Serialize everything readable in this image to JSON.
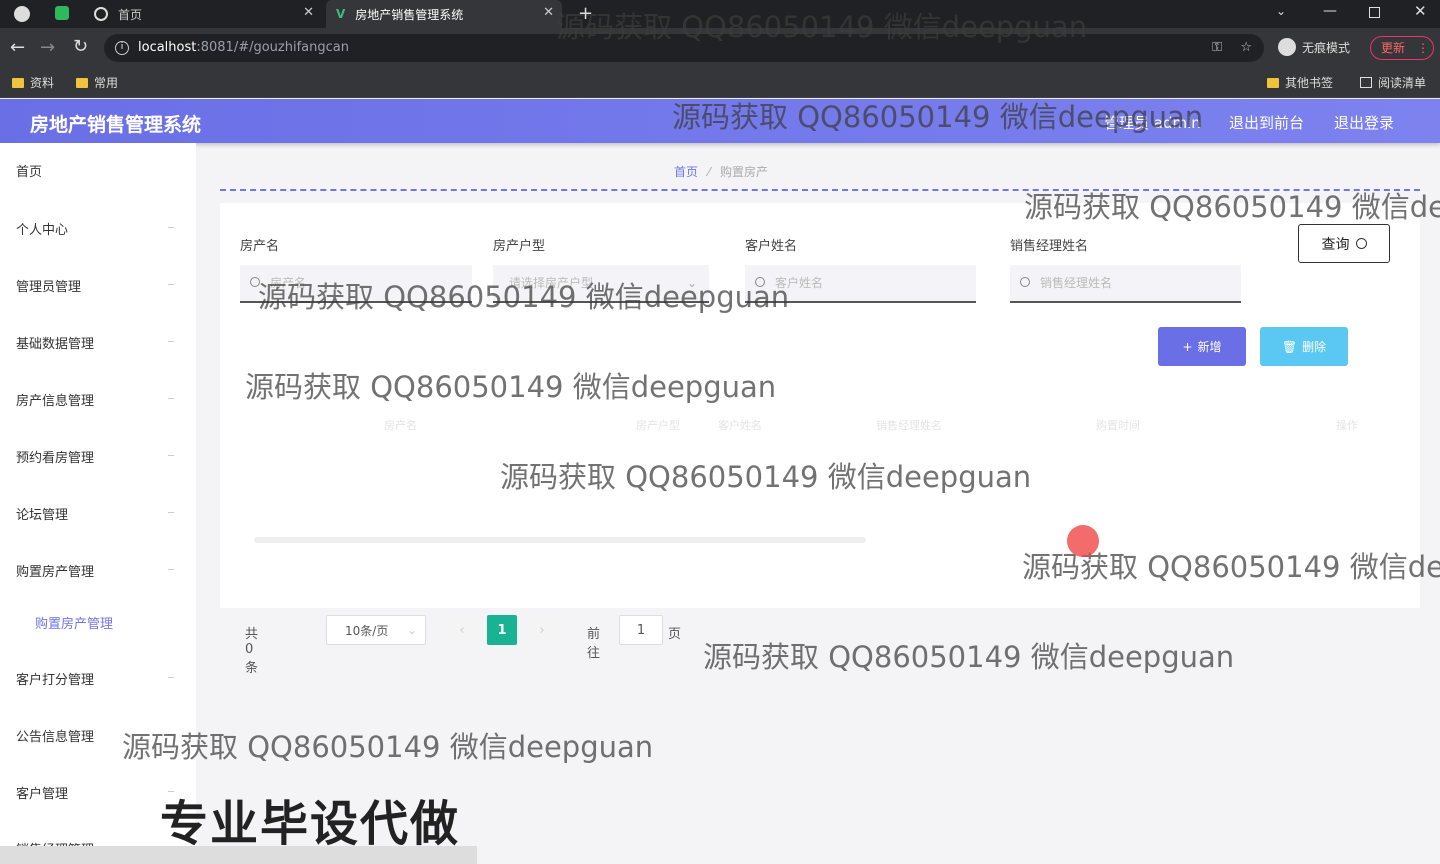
{
  "browser": {
    "tabs": [
      {
        "label": "首页",
        "icon": "globe-icon"
      },
      {
        "label": "房地产销售管理系统",
        "icon": "vue-logo-icon"
      }
    ],
    "url_host": "localhost",
    "url_rest": ":8081/#/gouzhifangcan",
    "incognito_label": "无痕模式",
    "update_label": "更新",
    "bookmarks": [
      "资料",
      "常用"
    ],
    "bookmarks_right": [
      "其他书签",
      "阅读清单"
    ]
  },
  "app": {
    "title": "房地产销售管理系统",
    "user_label": "管理员 admin",
    "front_link": "退出到前台",
    "logout_link": "退出登录"
  },
  "sidebar": {
    "items": [
      "首页",
      "个人中心",
      "管理员管理",
      "基础数据管理",
      "房产信息管理",
      "预约看房管理",
      "论坛管理",
      "购置房产管理",
      "客户打分管理",
      "公告信息管理",
      "客户管理",
      "销售经理管理"
    ],
    "sub_item": "购置房产管理"
  },
  "breadcrumb": {
    "home": "首页",
    "current": "购置房产"
  },
  "search": {
    "labels": [
      "房产名",
      "房产户型",
      "客户姓名",
      "销售经理姓名"
    ],
    "placeholders": [
      "房产名",
      "请选择房产户型",
      "客户姓名",
      "销售经理姓名"
    ],
    "query_button": "查询"
  },
  "actions": {
    "add": "新增",
    "delete": "删除"
  },
  "table": {
    "headers": [
      "房产名",
      "房产户型",
      "客户姓名",
      "销售经理姓名",
      "购置时间",
      "操作"
    ]
  },
  "pager": {
    "total": "共 0 条",
    "page_size": "10条/页",
    "current_page": "1",
    "goto_prefix": "前往",
    "goto_value": "1",
    "goto_suffix": "页"
  },
  "watermark": "源码获取 QQ86050149 微信deepguan",
  "banner": "专业毕设代做",
  "colors": {
    "primary": "#6a6fe6",
    "accent_blue": "#5bc7f3",
    "page_green": "#19b394"
  }
}
